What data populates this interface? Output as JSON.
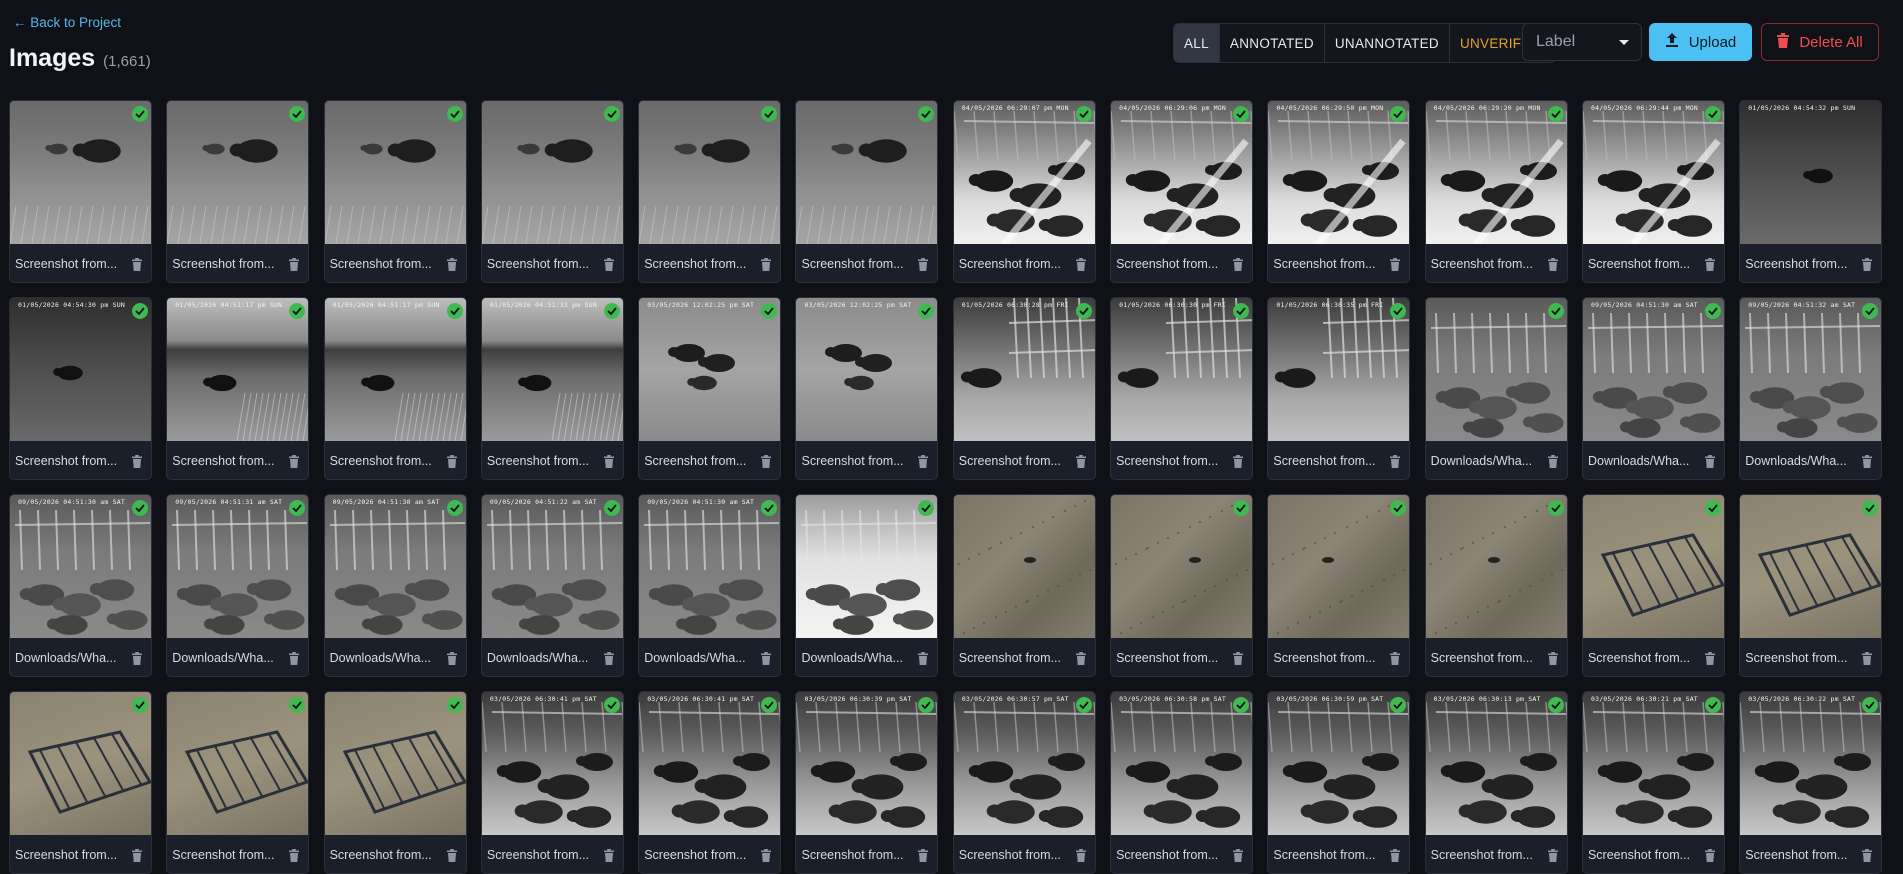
{
  "nav": {
    "back_label": "← Back to Project"
  },
  "header": {
    "title": "Images",
    "count": "(1,661)"
  },
  "filters": [
    {
      "label": "ALL",
      "active": true
    },
    {
      "label": "ANNOTATED",
      "active": false
    },
    {
      "label": "UNANNOTATED",
      "active": false
    },
    {
      "label": "UNVERIFIED",
      "active": false
    }
  ],
  "label_select": {
    "value": "Label"
  },
  "actions": {
    "upload_label": "Upload",
    "delete_all_label": "Delete All"
  },
  "colors": {
    "accent": "#4cc0f2",
    "danger": "#ef4e4e",
    "warning": "#e6a02c",
    "verified": "#3fb950",
    "background": "#0f1117"
  },
  "icons": {
    "verified": "check-circle-icon",
    "delete": "trash-icon",
    "upload": "upload-icon"
  },
  "images": [
    {
      "name": "Screenshot from...",
      "scene": "field",
      "stamp": "",
      "verified": true
    },
    {
      "name": "Screenshot from...",
      "scene": "field",
      "stamp": "",
      "verified": true
    },
    {
      "name": "Screenshot from...",
      "scene": "field",
      "stamp": "",
      "verified": true
    },
    {
      "name": "Screenshot from...",
      "scene": "field",
      "stamp": "",
      "verified": true
    },
    {
      "name": "Screenshot from...",
      "scene": "field",
      "stamp": "",
      "verified": true
    },
    {
      "name": "Screenshot from...",
      "scene": "field",
      "stamp": "",
      "verified": true
    },
    {
      "name": "Screenshot from...",
      "scene": "pen",
      "stamp": "04/05/2026 06:29:07 pm MON",
      "verified": true
    },
    {
      "name": "Screenshot from...",
      "scene": "pen",
      "stamp": "04/05/2026 06:29:06 pm MON",
      "verified": true
    },
    {
      "name": "Screenshot from...",
      "scene": "pen",
      "stamp": "04/05/2026 06:29:50 pm MON",
      "verified": true
    },
    {
      "name": "Screenshot from...",
      "scene": "pen",
      "stamp": "04/05/2026 06:29:20 pm MON",
      "verified": true
    },
    {
      "name": "Screenshot from...",
      "scene": "pen",
      "stamp": "04/05/2026 06:29:44 pm MON",
      "verified": true
    },
    {
      "name": "Screenshot from...",
      "scene": "dark",
      "stamp": "01/05/2026 04:54:32 pm SUN",
      "verified": false
    },
    {
      "name": "Screenshot from...",
      "scene": "dark",
      "stamp": "01/05/2026 04:54:30 pm SUN",
      "verified": true
    },
    {
      "name": "Screenshot from...",
      "scene": "hill",
      "stamp": "01/05/2026 04:51:17 pm SUN",
      "verified": true
    },
    {
      "name": "Screenshot from...",
      "scene": "hill",
      "stamp": "01/05/2026 04:51:17 pm SUN",
      "verified": true
    },
    {
      "name": "Screenshot from...",
      "scene": "hill",
      "stamp": "01/05/2026 04:51:33 pm SUN",
      "verified": true
    },
    {
      "name": "Screenshot from...",
      "scene": "lot",
      "stamp": "03/05/2026 12:02:25 pm SAT",
      "verified": true
    },
    {
      "name": "Screenshot from...",
      "scene": "lot",
      "stamp": "03/05/2026 12:02:25 pm SAT",
      "verified": true
    },
    {
      "name": "Screenshot from...",
      "scene": "gate",
      "stamp": "01/05/2026 06:30:28 pm FRI",
      "verified": true
    },
    {
      "name": "Screenshot from...",
      "scene": "gate",
      "stamp": "01/05/2026 06:30:30 pm FRI",
      "verified": true
    },
    {
      "name": "Screenshot from...",
      "scene": "gate",
      "stamp": "01/05/2026 06:30:35 pm FRI",
      "verified": true
    },
    {
      "name": "Downloads/Wha...",
      "scene": "fog",
      "stamp": "",
      "verified": true
    },
    {
      "name": "Downloads/Wha...",
      "scene": "fog",
      "stamp": "09/05/2026 04:51:30 am SAT",
      "verified": true
    },
    {
      "name": "Downloads/Wha...",
      "scene": "fog",
      "stamp": "09/05/2026 04:51:32 am SAT",
      "verified": true
    },
    {
      "name": "Downloads/Wha...",
      "scene": "fog",
      "stamp": "09/05/2026 04:51:30 am SAT",
      "verified": true
    },
    {
      "name": "Downloads/Wha...",
      "scene": "fog",
      "stamp": "09/05/2026 04:51:31 am SAT",
      "verified": true
    },
    {
      "name": "Downloads/Wha...",
      "scene": "fog",
      "stamp": "09/05/2026 04:51:30 am SAT",
      "verified": true
    },
    {
      "name": "Downloads/Wha...",
      "scene": "fog",
      "stamp": "09/05/2026 04:51:22 am SAT",
      "verified": true
    },
    {
      "name": "Downloads/Wha...",
      "scene": "fog",
      "stamp": "09/05/2026 04:51:30 am SAT",
      "verified": true
    },
    {
      "name": "Downloads/Wha...",
      "scene": "bright",
      "stamp": "",
      "verified": true
    },
    {
      "name": "Screenshot from...",
      "scene": "dirt",
      "stamp": "",
      "verified": false
    },
    {
      "name": "Screenshot from...",
      "scene": "dirt",
      "stamp": "",
      "verified": true
    },
    {
      "name": "Screenshot from...",
      "scene": "dirt",
      "stamp": "",
      "verified": true
    },
    {
      "name": "Screenshot from...",
      "scene": "dirt",
      "stamp": "",
      "verified": true
    },
    {
      "name": "Screenshot from...",
      "scene": "trap",
      "stamp": "",
      "verified": true
    },
    {
      "name": "Screenshot from...",
      "scene": "trap",
      "stamp": "",
      "verified": true
    },
    {
      "name": "Screenshot from...",
      "scene": "trap",
      "stamp": "",
      "verified": true
    },
    {
      "name": "Screenshot from...",
      "scene": "trap",
      "stamp": "",
      "verified": true
    },
    {
      "name": "Screenshot from...",
      "scene": "trap",
      "stamp": "",
      "verified": true
    },
    {
      "name": "Screenshot from...",
      "scene": "barn",
      "stamp": "03/05/2026 06:30:41 pm SAT",
      "verified": true
    },
    {
      "name": "Screenshot from...",
      "scene": "barn",
      "stamp": "03/05/2026 06:30:41 pm SAT",
      "verified": true
    },
    {
      "name": "Screenshot from...",
      "scene": "barn",
      "stamp": "03/05/2026 06:30:39 pm SAT",
      "verified": true
    },
    {
      "name": "Screenshot from...",
      "scene": "barn",
      "stamp": "03/05/2026 06:30:57 pm SAT",
      "verified": true
    },
    {
      "name": "Screenshot from...",
      "scene": "barn",
      "stamp": "03/05/2026 06:30:58 pm SAT",
      "verified": true
    },
    {
      "name": "Screenshot from...",
      "scene": "barn",
      "stamp": "03/05/2026 06:30:59 pm SAT",
      "verified": true
    },
    {
      "name": "Screenshot from...",
      "scene": "barn",
      "stamp": "03/05/2026 06:30:13 pm SAT",
      "verified": true
    },
    {
      "name": "Screenshot from...",
      "scene": "barn",
      "stamp": "03/05/2026 06:30:21 pm SAT",
      "verified": true
    },
    {
      "name": "Screenshot from...",
      "scene": "barn",
      "stamp": "03/05/2026 06:30:22 pm SAT",
      "verified": true
    }
  ]
}
